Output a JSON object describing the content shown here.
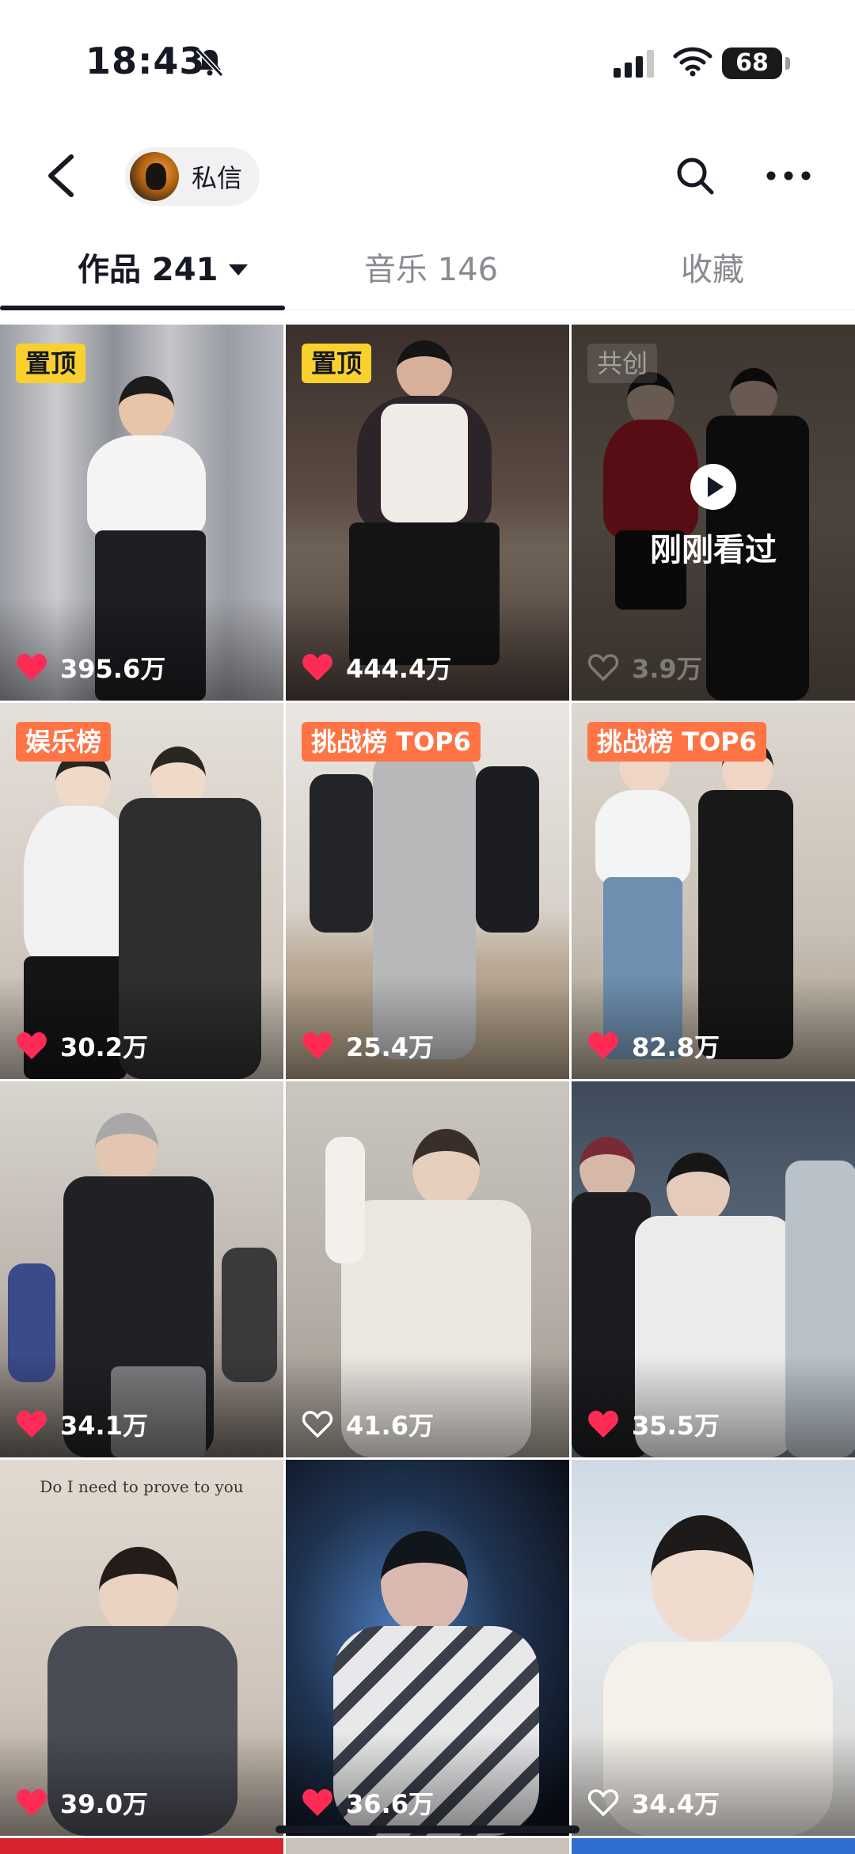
{
  "status_bar": {
    "time": "18:43",
    "battery": "68"
  },
  "nav": {
    "chip_label": "私信"
  },
  "tabs": [
    {
      "label": "作品 241"
    },
    {
      "label": "音乐 146"
    },
    {
      "label": "收藏"
    }
  ],
  "videos": [
    {
      "badge": "置顶",
      "likes": "395.6万"
    },
    {
      "badge": "置顶",
      "likes": "444.4万"
    },
    {
      "badge": "共创",
      "likes": "3.9万",
      "overlay": "刚刚看过"
    },
    {
      "badge": "娱乐榜",
      "likes": "30.2万"
    },
    {
      "badge": "挑战榜 TOP6",
      "likes": "25.4万"
    },
    {
      "badge": "挑战榜 TOP6",
      "likes": "82.8万"
    },
    {
      "likes": "34.1万"
    },
    {
      "likes": "41.6万"
    },
    {
      "likes": "35.5万"
    },
    {
      "likes": "39.0万",
      "caption": "Do I need to prove to you"
    },
    {
      "likes": "36.6万"
    },
    {
      "likes": "34.4万"
    }
  ],
  "colors": {
    "accent_heart": "#fe2c55",
    "pin_badge": "#fad02e",
    "rank_badge": "#ff7345"
  }
}
